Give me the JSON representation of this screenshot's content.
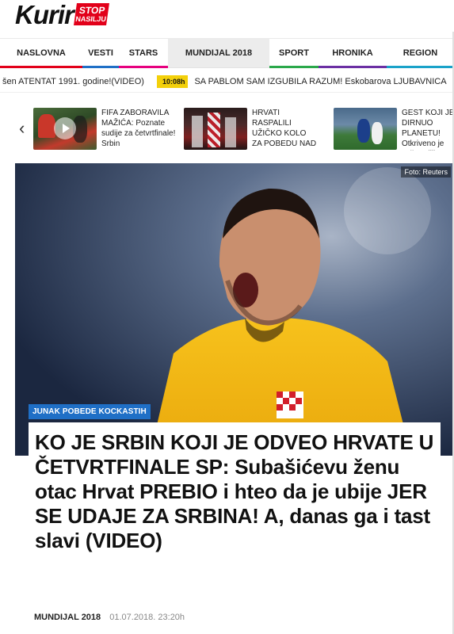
{
  "logo": {
    "word": "Kurir",
    "stop_line1": "STOP",
    "stop_line2": "NASILJU"
  },
  "nav": [
    {
      "label": "NASLOVNA",
      "accent": "#e2001a",
      "active": false
    },
    {
      "label": "VESTI",
      "accent": "#1f6fc6",
      "active": false
    },
    {
      "label": "STARS",
      "accent": "#e6007e",
      "active": false
    },
    {
      "label": "MUNDIJAL 2018",
      "accent": "#ffffff",
      "active": true
    },
    {
      "label": "SPORT",
      "accent": "#2aa84a",
      "active": false
    },
    {
      "label": "HRONIKA",
      "accent": "#6b2fa3",
      "active": false
    },
    {
      "label": "REGION",
      "accent": "#1aa2c9",
      "active": false
    }
  ],
  "ticker": {
    "left_text": "šen ATENTAT 1991. godine!(VIDEO)",
    "time": "10:08h",
    "right_text": "SA PABLOM SAM IZGUBILA RAZUM! Eskobarova LJUBAVNICA"
  },
  "related": [
    {
      "title": "FIFA ZABORAVILA MAŽIĆA: Poznate sudije za četvrtfinale! Srbin",
      "has_video": true
    },
    {
      "title": "HRVATI RASPALILI UŽIČKO KOLO ZA POBEDU NAD DANSKOM!",
      "has_video": false
    },
    {
      "title": "GEST KOJI JE DIRNUO PLANETU! Otkriveno je zašto Kilijan Mbape",
      "has_video": false
    }
  ],
  "hero": {
    "photo_credit": "Foto: Reuters",
    "kicker": "JUNAK POBEDE KOCKASTIH",
    "headline": "KO JE SRBIN KOJI JE ODVEO HRVATE U ČETVRTFINALE SP: Subašićevu ženu otac Hrvat PREBIO i hteo da je ubije JER SE UDAJE ZA SRBINA! A, danas ga i tast slavi (VIDEO)",
    "category": "MUNDIJAL 2018",
    "date": "01.07.2018. 23:20h"
  },
  "icons": {
    "prev": "chevron-left-icon",
    "play": "play-icon"
  }
}
